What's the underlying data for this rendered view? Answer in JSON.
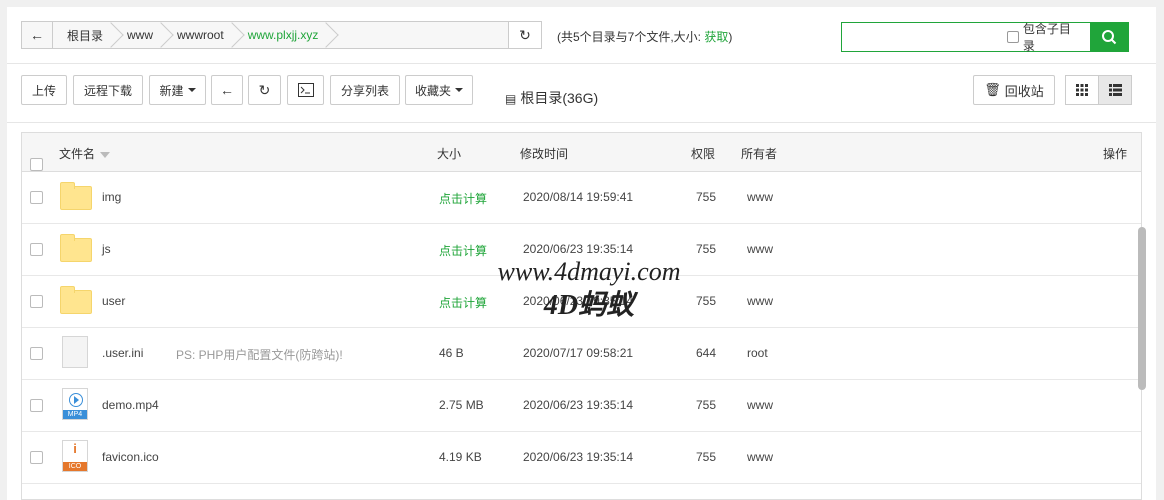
{
  "path": {
    "back_icon": "arrow-left-icon",
    "crumbs": [
      "根目录",
      "www",
      "wwwroot",
      "www.plxjj.xyz"
    ],
    "refresh_icon": "refresh-icon"
  },
  "summary": {
    "text": "(共5个目录与7个文件,大小:",
    "link": "获取",
    "suffix": ")"
  },
  "search": {
    "placeholder": "",
    "subdir_label": "包含子目录",
    "icon": "search-icon"
  },
  "toolbar": {
    "upload": "上传",
    "remote_download": "远程下载",
    "new": "新建",
    "share_list": "分享列表",
    "favorites": "收藏夹",
    "disk_label": "根目录(36G)",
    "recycle_bin": "回收站"
  },
  "table": {
    "headers": {
      "name": "文件名",
      "size": "大小",
      "mtime": "修改时间",
      "perm": "权限",
      "owner": "所有者",
      "action": "操作"
    },
    "rows": [
      {
        "type": "folder",
        "name": "img",
        "note": "",
        "size": "点击计算",
        "mtime": "2020/08/14 19:59:41",
        "perm": "755",
        "owner": "www"
      },
      {
        "type": "folder",
        "name": "js",
        "note": "",
        "size": "点击计算",
        "mtime": "2020/06/23 19:35:14",
        "perm": "755",
        "owner": "www"
      },
      {
        "type": "folder",
        "name": "user",
        "note": "",
        "size": "点击计算",
        "mtime": "2020/06/23 19:35:14",
        "perm": "755",
        "owner": "www"
      },
      {
        "type": "file",
        "name": ".user.ini",
        "note": "PS: PHP用户配置文件(防跨站)!",
        "size": "46 B",
        "mtime": "2020/07/17 09:58:21",
        "perm": "644",
        "owner": "root"
      },
      {
        "type": "mp4",
        "name": "demo.mp4",
        "note": "",
        "size": "2.75 MB",
        "mtime": "2020/06/23 19:35:14",
        "perm": "755",
        "owner": "www"
      },
      {
        "type": "ico",
        "name": "favicon.ico",
        "note": "",
        "size": "4.19 KB",
        "mtime": "2020/06/23 19:35:14",
        "perm": "755",
        "owner": "www"
      }
    ]
  },
  "file_icons": {
    "mp4_tag": "MP4",
    "ico_glyph": "i",
    "ico_tag": "ICO"
  },
  "watermark": {
    "line1": "www.4dmayi.com",
    "line2": "4D蚂蚁"
  },
  "colors": {
    "accent": "#20a53a"
  }
}
